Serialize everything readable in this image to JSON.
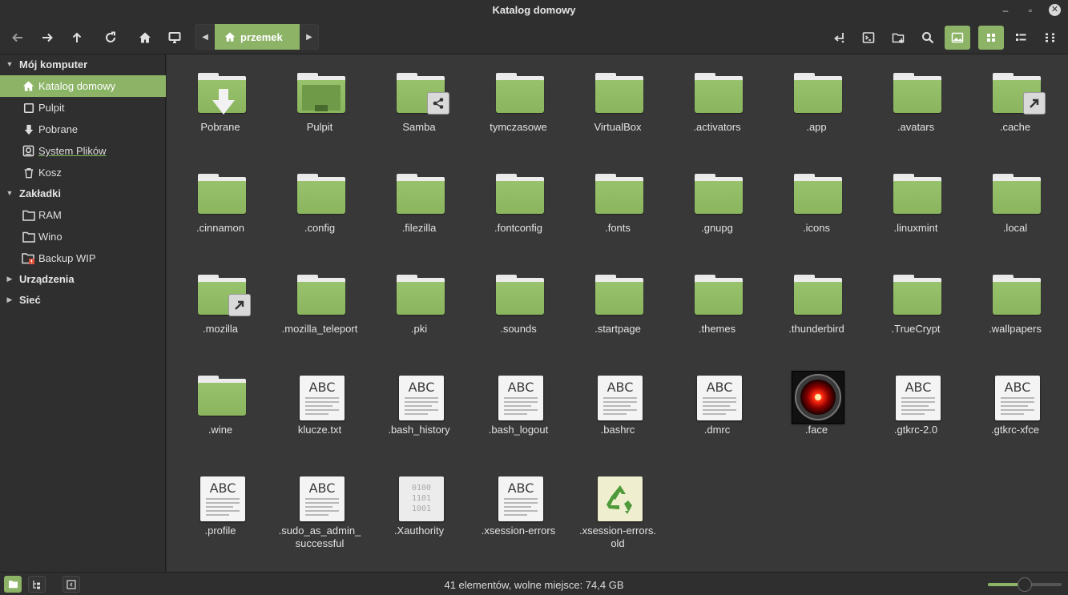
{
  "window": {
    "title": "Katalog domowy"
  },
  "pathbar": {
    "crumb": "przemek"
  },
  "sidebar": {
    "sections": {
      "computer": "Mój komputer",
      "bookmarks": "Zakładki",
      "devices": "Urządzenia",
      "network": "Sieć"
    },
    "items": [
      {
        "label": "Katalog domowy",
        "icon": "home-icon"
      },
      {
        "label": "Pulpit",
        "icon": "desktop-icon"
      },
      {
        "label": "Pobrane",
        "icon": "download-icon"
      },
      {
        "label": "System Plików",
        "icon": "drive-icon"
      },
      {
        "label": "Kosz",
        "icon": "trash-icon"
      },
      {
        "label": "RAM",
        "icon": "folder-icon"
      },
      {
        "label": "Wino",
        "icon": "folder-icon"
      },
      {
        "label": "Backup WIP",
        "icon": "folder-warning-icon"
      }
    ]
  },
  "files": [
    {
      "name": "Pobrane",
      "type": "folder-download"
    },
    {
      "name": "Pulpit",
      "type": "folder-desktop"
    },
    {
      "name": "Samba",
      "type": "folder-shared"
    },
    {
      "name": "tymczasowe",
      "type": "folder"
    },
    {
      "name": "VirtualBox",
      "type": "folder"
    },
    {
      "name": ".activators",
      "type": "folder"
    },
    {
      "name": ".app",
      "type": "folder"
    },
    {
      "name": ".avatars",
      "type": "folder"
    },
    {
      "name": ".cache",
      "type": "folder-link"
    },
    {
      "name": ".cinnamon",
      "type": "folder"
    },
    {
      "name": ".config",
      "type": "folder"
    },
    {
      "name": ".filezilla",
      "type": "folder"
    },
    {
      "name": ".fontconfig",
      "type": "folder"
    },
    {
      "name": ".fonts",
      "type": "folder"
    },
    {
      "name": ".gnupg",
      "type": "folder"
    },
    {
      "name": ".icons",
      "type": "folder"
    },
    {
      "name": ".linuxmint",
      "type": "folder"
    },
    {
      "name": ".local",
      "type": "folder"
    },
    {
      "name": ".mozilla",
      "type": "folder-link"
    },
    {
      "name": ".mozilla_teleport",
      "type": "folder"
    },
    {
      "name": ".pki",
      "type": "folder"
    },
    {
      "name": ".sounds",
      "type": "folder"
    },
    {
      "name": ".startpage",
      "type": "folder"
    },
    {
      "name": ".themes",
      "type": "folder"
    },
    {
      "name": ".thunderbird",
      "type": "folder"
    },
    {
      "name": ".TrueCrypt",
      "type": "folder"
    },
    {
      "name": ".wallpapers",
      "type": "folder"
    },
    {
      "name": ".wine",
      "type": "folder"
    },
    {
      "name": "klucze.txt",
      "type": "text"
    },
    {
      "name": ".bash_history",
      "type": "text"
    },
    {
      "name": ".bash_logout",
      "type": "text"
    },
    {
      "name": ".bashrc",
      "type": "text"
    },
    {
      "name": ".dmrc",
      "type": "text"
    },
    {
      "name": ".face",
      "type": "image"
    },
    {
      "name": ".gtkrc-2.0",
      "type": "text"
    },
    {
      "name": ".gtkrc-xfce",
      "type": "text"
    },
    {
      "name": ".profile",
      "type": "text"
    },
    {
      "name": ".sudo_as_admin_\nsuccessful",
      "type": "text"
    },
    {
      "name": ".Xauthority",
      "type": "binary",
      "binary_text": "0100\n1101\n1001"
    },
    {
      "name": ".xsession-errors",
      "type": "text"
    },
    {
      "name": ".xsession-errors.\nold",
      "type": "recycle"
    }
  ],
  "doc_glyph": "ABC",
  "status": {
    "text": "41 elementów, wolne miejsce: 74,4 GB",
    "zoom_level": 0.5
  },
  "colors": {
    "accent": "#8cb366",
    "folder": "#8ab55e",
    "background": "#383838"
  }
}
